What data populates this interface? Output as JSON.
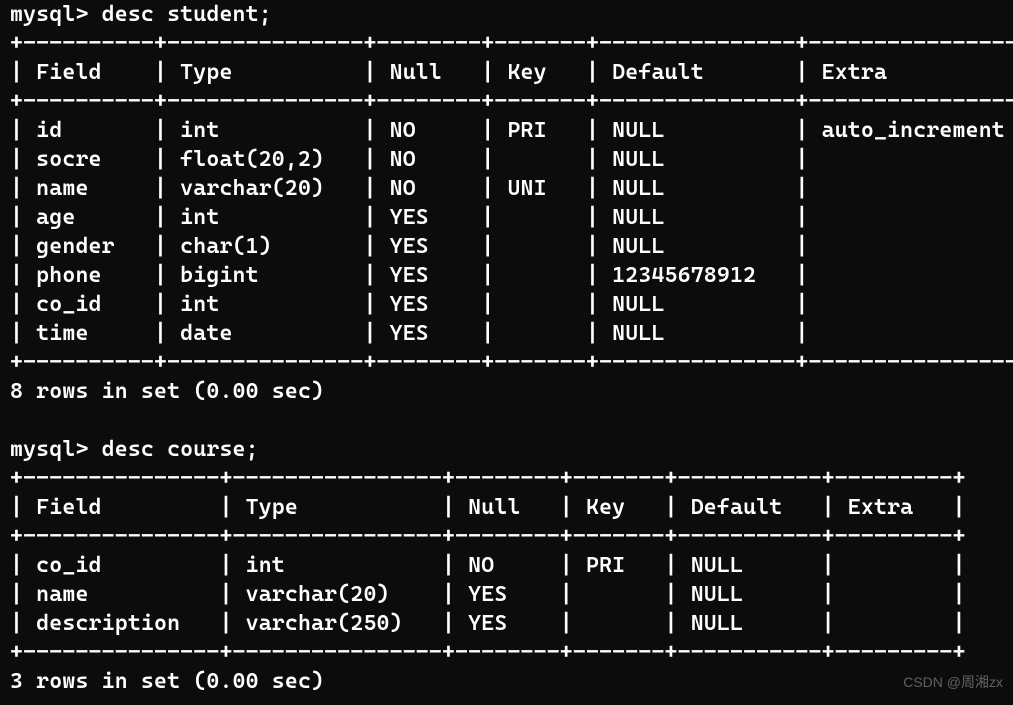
{
  "prompt": "mysql> ",
  "blocks": [
    {
      "command": "desc student;",
      "columns": [
        "Field",
        "Type",
        "Null",
        "Key",
        "Default",
        "Extra"
      ],
      "widths": [
        8,
        13,
        6,
        5,
        13,
        16
      ],
      "rows": [
        [
          "id",
          "int",
          "NO",
          "PRI",
          "NULL",
          "auto_increment"
        ],
        [
          "socre",
          "float(20,2)",
          "NO",
          "",
          "NULL",
          ""
        ],
        [
          "name",
          "varchar(20)",
          "NO",
          "UNI",
          "NULL",
          ""
        ],
        [
          "age",
          "int",
          "YES",
          "",
          "NULL",
          ""
        ],
        [
          "gender",
          "char(1)",
          "YES",
          "",
          "NULL",
          ""
        ],
        [
          "phone",
          "bigint",
          "YES",
          "",
          "12345678912",
          ""
        ],
        [
          "co_id",
          "int",
          "YES",
          "",
          "NULL",
          ""
        ],
        [
          "time",
          "date",
          "YES",
          "",
          "NULL",
          ""
        ]
      ],
      "summary": "8 rows in set (0.00 sec)"
    },
    {
      "command": "desc course;",
      "columns": [
        "Field",
        "Type",
        "Null",
        "Key",
        "Default",
        "Extra"
      ],
      "widths": [
        13,
        14,
        6,
        5,
        9,
        7
      ],
      "rows": [
        [
          "co_id",
          "int",
          "NO",
          "PRI",
          "NULL",
          ""
        ],
        [
          "name",
          "varchar(20)",
          "YES",
          "",
          "NULL",
          ""
        ],
        [
          "description",
          "varchar(250)",
          "YES",
          "",
          "NULL",
          ""
        ]
      ],
      "summary": "3 rows in set (0.00 sec)"
    }
  ],
  "watermark": "CSDN @周湘zx"
}
